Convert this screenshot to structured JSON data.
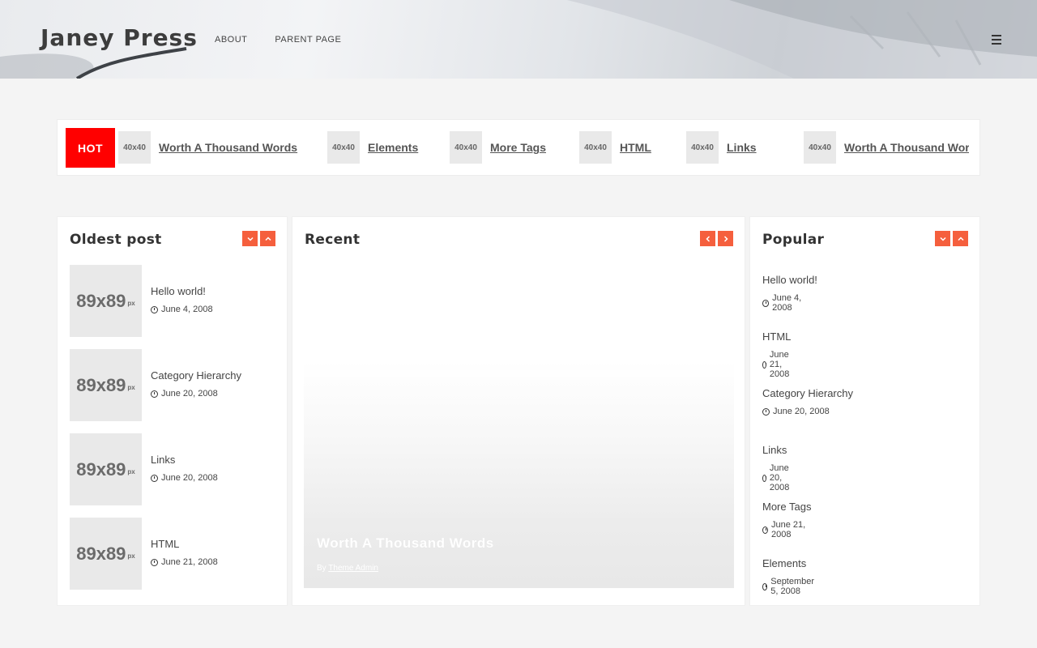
{
  "header": {
    "site_title": "Janey Press",
    "nav": [
      "About",
      "Parent Page"
    ],
    "menu_icon": "hamburger-menu-icon"
  },
  "ticker": {
    "hot_label": "HOT",
    "thumb_label": "40x40",
    "items": [
      "Worth A Thousand Words",
      "Elements",
      "More Tags",
      "HTML",
      "Links",
      "Worth A Thousand Words"
    ]
  },
  "oldest": {
    "title": "Oldest post",
    "thumb_label": "89x89",
    "thumb_unit": "px",
    "posts": [
      {
        "title": "Hello world!",
        "date": "June 4, 2008"
      },
      {
        "title": "Category Hierarchy",
        "date": "June 20, 2008"
      },
      {
        "title": "Links",
        "date": "June 20, 2008"
      },
      {
        "title": "HTML",
        "date": "June 21, 2008"
      }
    ]
  },
  "recent": {
    "title": "Recent",
    "featured_title": "Worth A Thousand Words",
    "by_label": "By",
    "author": "Theme Admin"
  },
  "popular": {
    "title": "Popular",
    "posts": [
      {
        "title": "Hello world!",
        "date": "June 4, 2008"
      },
      {
        "title": "HTML",
        "date": "June 21, 2008"
      },
      {
        "title": "Category Hierarchy",
        "date": "June 20, 2008"
      },
      {
        "title": "Links",
        "date": "June 20, 2008"
      },
      {
        "title": "More Tags",
        "date": "June 21, 2008"
      },
      {
        "title": "Elements",
        "date": "September 5, 2008"
      }
    ]
  },
  "colors": {
    "accent": "#f55f3d",
    "hot": "#ff0000",
    "page_bg": "#f4f4f4"
  }
}
